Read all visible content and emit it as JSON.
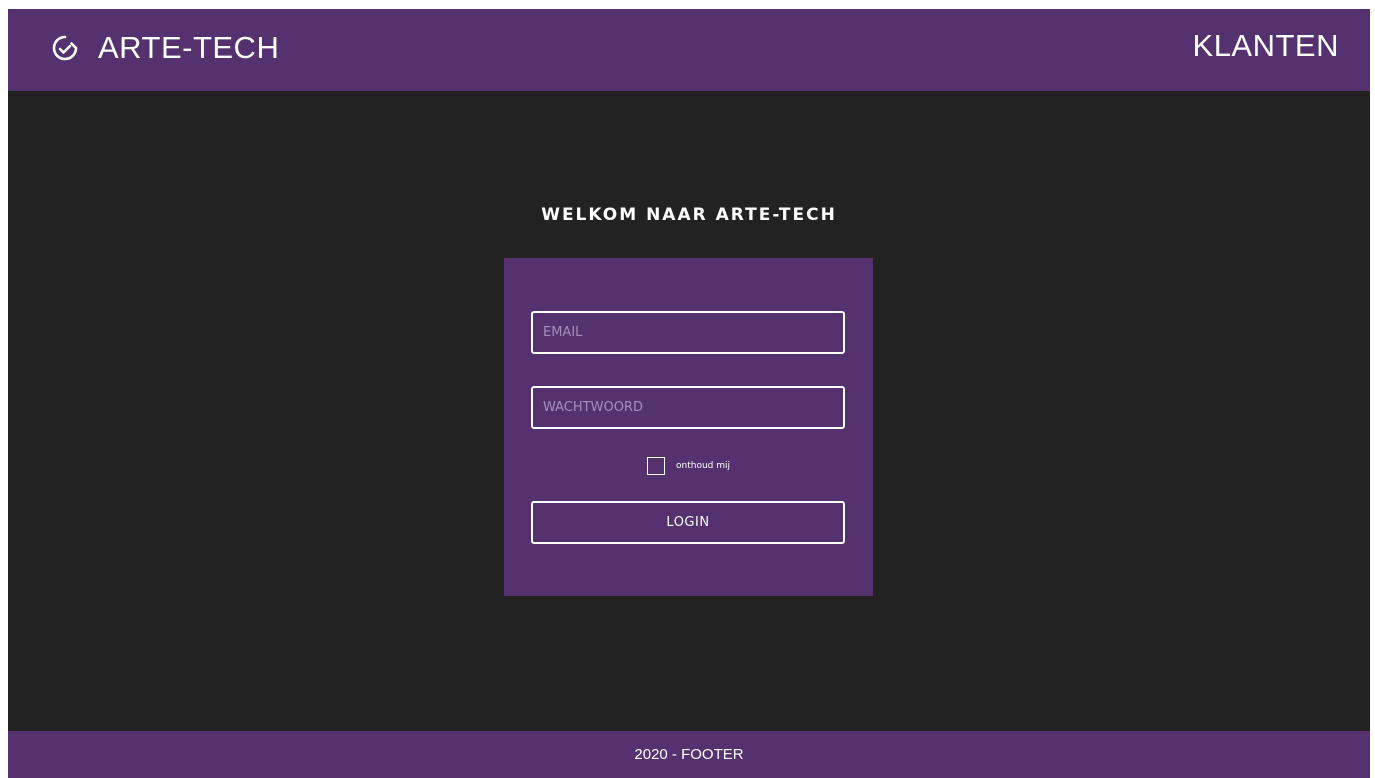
{
  "colors": {
    "brand_purple": "#553170",
    "background_dark": "#222222",
    "text": "#ffffff",
    "placeholder": "#a58fb8"
  },
  "header": {
    "brand_name": "ARTE-TECH",
    "logo_icon": "circle-check-logo-icon",
    "nav_link": "KLANTEN"
  },
  "login": {
    "welcome_title": "WELKOM NAAR ARTE-TECH",
    "email": {
      "placeholder": "EMAIL",
      "value": ""
    },
    "password": {
      "placeholder": "WACHTWOORD",
      "value": ""
    },
    "remember": {
      "label": "onthoud mij",
      "checked": false
    },
    "login_button": "LOGIN"
  },
  "footer": {
    "text": "2020 - FOOTER"
  }
}
